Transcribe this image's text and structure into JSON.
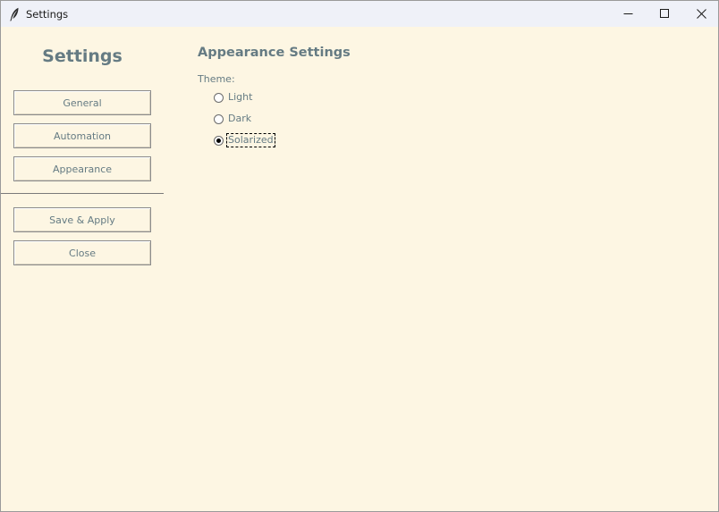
{
  "window": {
    "title": "Settings",
    "controls": {
      "minimize": "minimize-icon",
      "maximize": "maximize-icon",
      "close": "close-icon"
    }
  },
  "sidebar": {
    "title": "Settings",
    "nav_buttons": [
      {
        "label": "General"
      },
      {
        "label": "Automation"
      },
      {
        "label": "Appearance"
      }
    ],
    "action_buttons": [
      {
        "label": "Save & Apply"
      },
      {
        "label": "Close"
      }
    ]
  },
  "main": {
    "heading": "Appearance Settings",
    "theme_label": "Theme:",
    "theme_options": [
      {
        "label": "Light",
        "selected": false
      },
      {
        "label": "Dark",
        "selected": false
      },
      {
        "label": "Solarized",
        "selected": true
      }
    ]
  },
  "colors": {
    "background": "#fdf6e3",
    "text": "#657b83",
    "titlebar": "#eff1f8"
  }
}
